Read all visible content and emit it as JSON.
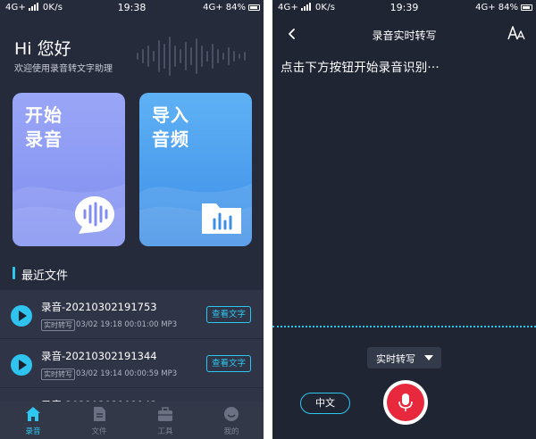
{
  "left": {
    "status": {
      "network": "4G+",
      "speed": "0K/s",
      "time": "19:38",
      "net_right": "4G+",
      "battery": "84%"
    },
    "greeting": "Hi 您好",
    "greeting_sub": "欢迎使用录音转文字助理",
    "cards": {
      "record": {
        "line1": "开始",
        "line2": "录音",
        "icon": "voice-wave-chat-icon"
      },
      "import": {
        "line1": "导入",
        "line2": "音频",
        "icon": "audio-folder-icon"
      }
    },
    "section_title": "最近文件",
    "files": [
      {
        "name": "录音-20210302191753",
        "tag": "实时转写",
        "meta": "03/02 19:18  00:01:00  MP3",
        "action": "查看文字"
      },
      {
        "name": "录音-20210302191344",
        "tag": "实时转写",
        "meta": "03/02 19:14  00:00:59  MP3",
        "action": "查看文字"
      },
      {
        "name": "录音-20210302191143"
      }
    ],
    "tabs": [
      {
        "label": "录音",
        "icon": "home-icon",
        "active": true
      },
      {
        "label": "文件",
        "icon": "file-icon"
      },
      {
        "label": "工具",
        "icon": "toolbox-icon"
      },
      {
        "label": "我的",
        "icon": "profile-face-icon"
      }
    ],
    "accent_color": "#2ec7f0"
  },
  "right": {
    "status": {
      "network": "4G+",
      "speed": "0K/s",
      "time": "19:39",
      "net_right": "4G+",
      "battery": "84%"
    },
    "title": "录音实时转写",
    "hint": "点击下方按钮开始录音识别···",
    "mode": "实时转写",
    "language": "中文",
    "record_color": "#e8283c"
  }
}
